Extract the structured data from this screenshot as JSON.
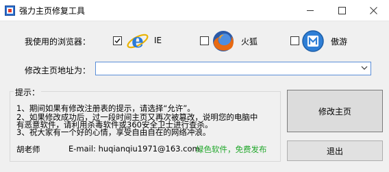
{
  "window": {
    "title": "强力主页修复工具",
    "colors": {
      "accent": "#5a8ed8",
      "green": "#22a82c",
      "title_bg": "#ffffff",
      "body_bg": "#f0f0f0"
    }
  },
  "icons": {
    "app": "app-icon",
    "ie": "internet-explorer-icon",
    "firefox": "firefox-icon",
    "maxthon": "maxthon-icon"
  },
  "browsers": {
    "label": "我使用的浏览器：",
    "items": [
      {
        "name": "IE",
        "checked": true
      },
      {
        "name": "火狐",
        "checked": false
      },
      {
        "name": "傲游",
        "checked": false
      }
    ]
  },
  "homepage": {
    "label": "修改主页地址为：",
    "value": ""
  },
  "tips": {
    "title": "提示：",
    "lines": [
      "1、期间如果有修改注册表的提示，请选择“允许”。",
      "2、如果修改成功后，过一段时间主页又再次被篡改，说明您的电脑中",
      "有恶意软件，请利用杀毒软件或360安全卫士进行查杀。",
      "3、祝大家有一个好的心情，享受自由自在的网络冲浪。"
    ],
    "author": "胡老师",
    "email": "E-mail: huqianqiu1971@163.com",
    "note": "绿色软件，免费发布"
  },
  "buttons": {
    "modify": "修改主页",
    "exit": "退出"
  }
}
